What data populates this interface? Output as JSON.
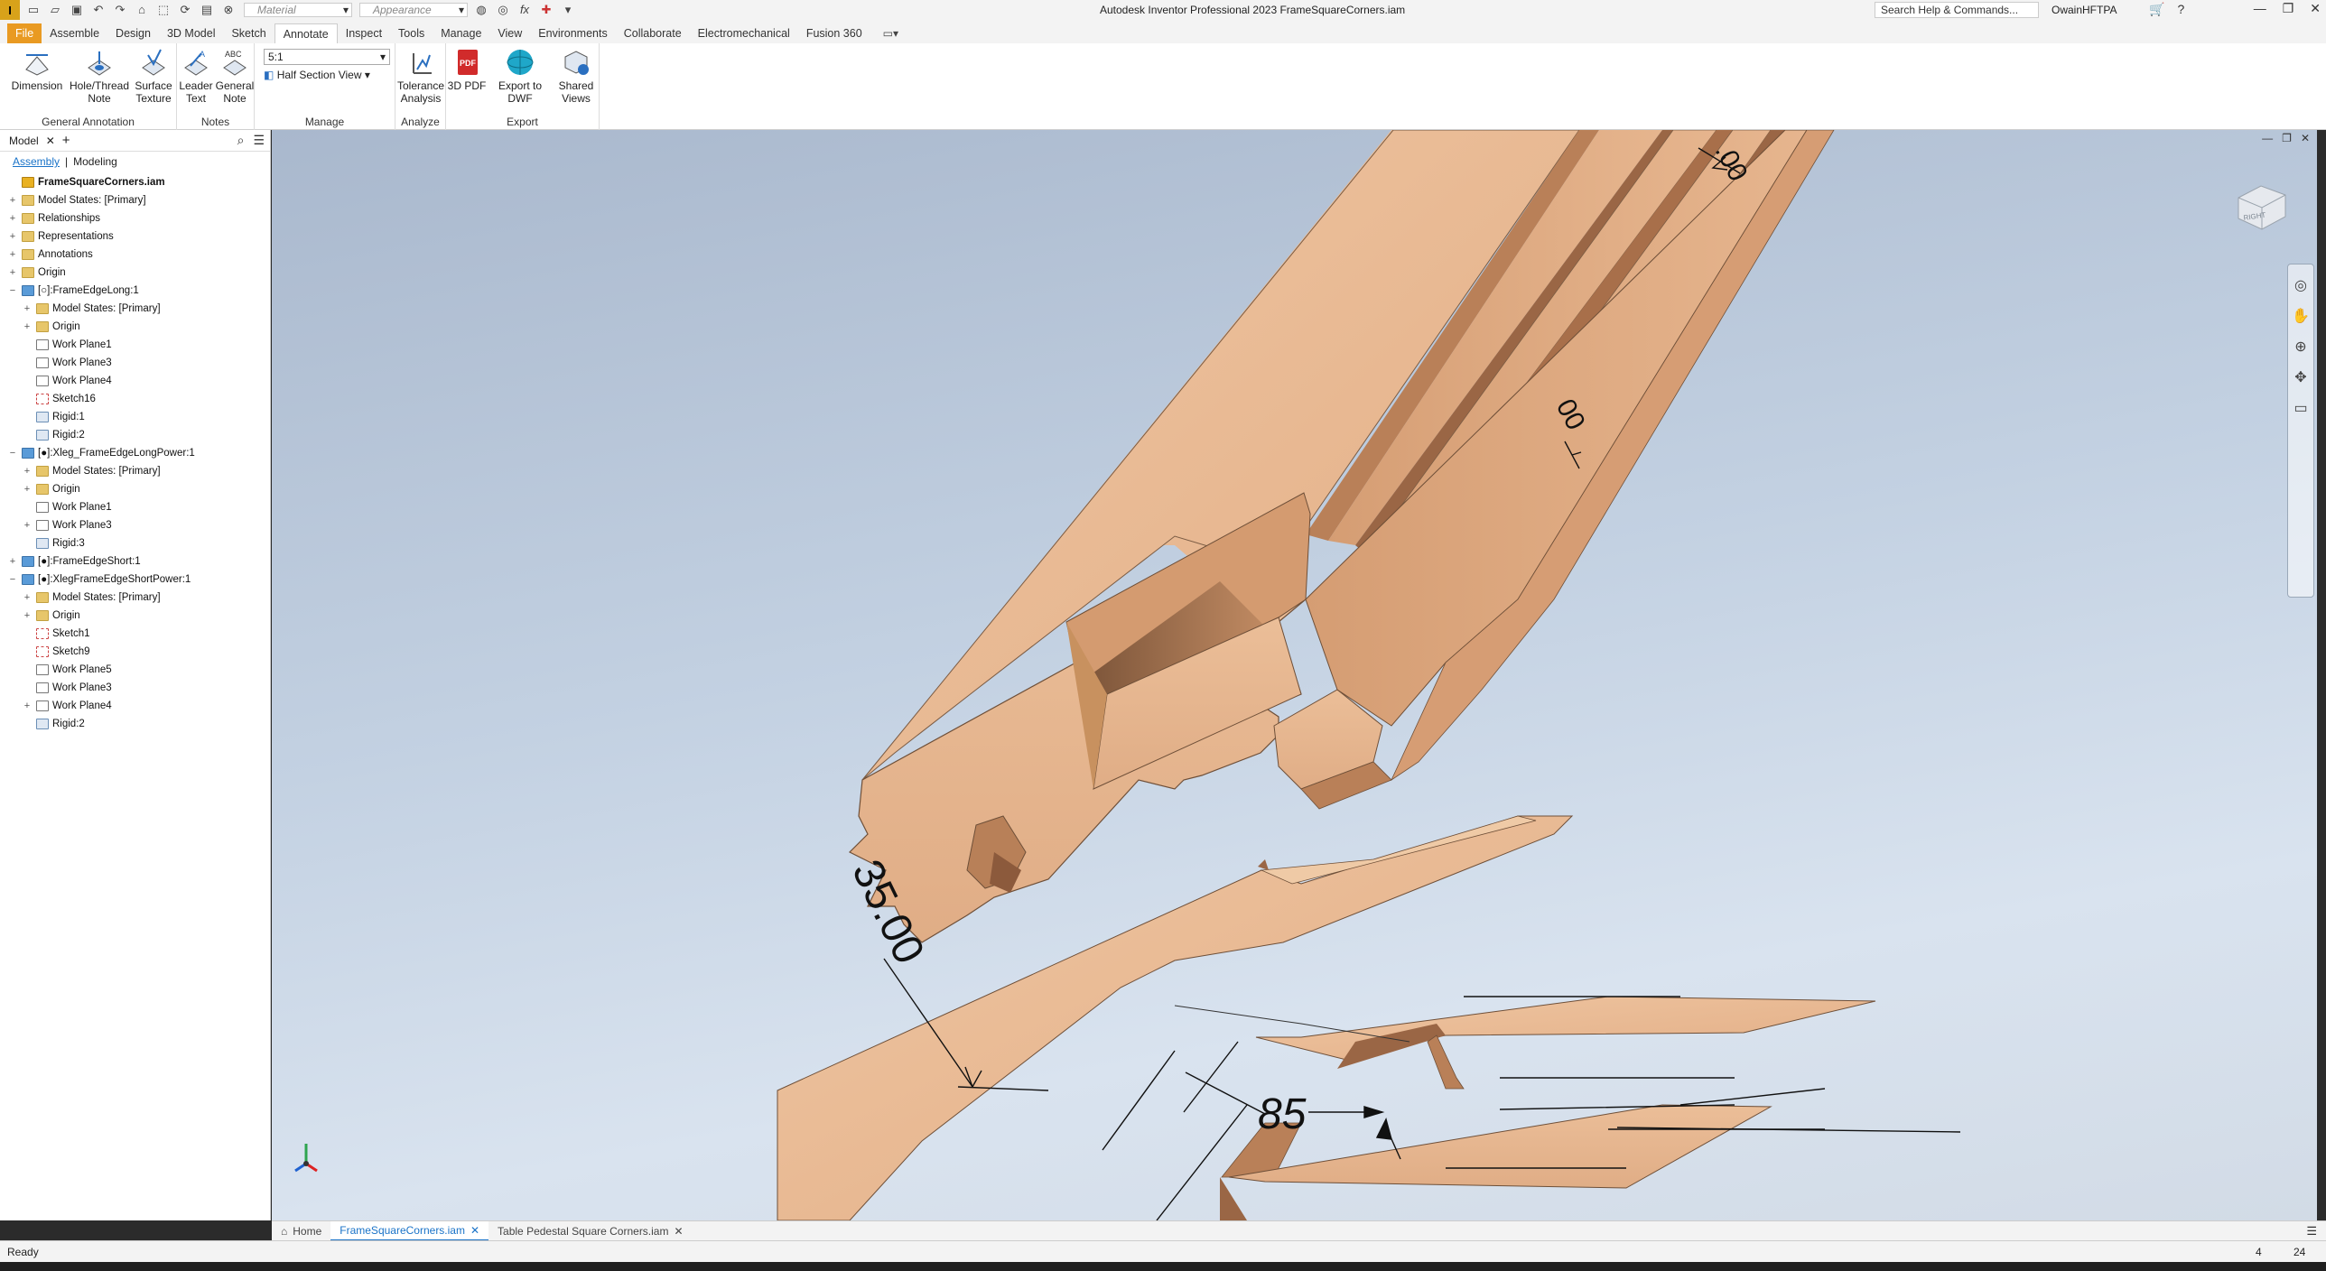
{
  "app": {
    "logo": "I",
    "window_title": "Autodesk Inventor Professional 2023   FrameSquareCorners.iam",
    "material_placeholder": "Material",
    "appearance_placeholder": "Appearance",
    "search_placeholder": "Search Help & Commands...",
    "user": "OwainHFTPA"
  },
  "ribbon_tabs": [
    "File",
    "Assemble",
    "Design",
    "3D Model",
    "Sketch",
    "Annotate",
    "Inspect",
    "Tools",
    "Manage",
    "View",
    "Environments",
    "Collaborate",
    "Electromechanical",
    "Fusion 360"
  ],
  "ribbon": {
    "general_annotation": {
      "label": "General Annotation",
      "dimension": "Dimension",
      "hole_thread_note": [
        "Hole/Thread",
        "Note"
      ],
      "surface_texture": [
        "Surface",
        "Texture"
      ]
    },
    "notes": {
      "label": "Notes",
      "leader_text": [
        "Leader",
        "Text"
      ],
      "general_note": [
        "General",
        "Note"
      ],
      "general_note_icon_text": "ABC"
    },
    "manage": {
      "label": "Manage",
      "scale": "5:1",
      "half_section_view": "Half Section View"
    },
    "analyze": {
      "label": "Analyze",
      "tolerance_analysis": [
        "Tolerance",
        "Analysis"
      ]
    },
    "export": {
      "label": "Export",
      "pdf": "3D PDF",
      "pdf_icon_text": "PDF",
      "dwf": "Export to DWF",
      "shared_views": [
        "Shared",
        "Views"
      ]
    }
  },
  "browser": {
    "tab": "Model",
    "sub_tabs": [
      "Assembly",
      "Modeling"
    ],
    "tree": [
      {
        "label": "FrameSquareCorners.iam",
        "level": 0,
        "icon": "asm",
        "exp": ""
      },
      {
        "label": "Model States: [Primary]",
        "level": 0,
        "icon": "folder",
        "exp": "+"
      },
      {
        "label": "Relationships",
        "level": 0,
        "icon": "folder",
        "exp": "+"
      },
      {
        "label": "Representations",
        "level": 0,
        "icon": "folder",
        "exp": "+"
      },
      {
        "label": "Annotations",
        "level": 0,
        "icon": "folder",
        "exp": "+"
      },
      {
        "label": "Origin",
        "level": 0,
        "icon": "folder",
        "exp": "+"
      },
      {
        "label": "[○]:FrameEdgeLong:1",
        "level": 0,
        "icon": "part",
        "exp": "−"
      },
      {
        "label": "Model States: [Primary]",
        "level": 1,
        "icon": "folder",
        "exp": "+"
      },
      {
        "label": "Origin",
        "level": 1,
        "icon": "folder",
        "exp": "+"
      },
      {
        "label": "Work Plane1",
        "level": 1,
        "icon": "plane",
        "exp": ""
      },
      {
        "label": "Work Plane3",
        "level": 1,
        "icon": "plane",
        "exp": ""
      },
      {
        "label": "Work Plane4",
        "level": 1,
        "icon": "plane",
        "exp": ""
      },
      {
        "label": "Sketch16",
        "level": 1,
        "icon": "sketch",
        "exp": ""
      },
      {
        "label": "Rigid:1",
        "level": 1,
        "icon": "rigid",
        "exp": ""
      },
      {
        "label": "Rigid:2",
        "level": 1,
        "icon": "rigid",
        "exp": ""
      },
      {
        "label": "[●]:Xleg_FrameEdgeLongPower:1",
        "level": 0,
        "icon": "part",
        "exp": "−"
      },
      {
        "label": "Model States: [Primary]",
        "level": 1,
        "icon": "folder",
        "exp": "+"
      },
      {
        "label": "Origin",
        "level": 1,
        "icon": "folder",
        "exp": "+"
      },
      {
        "label": "Work Plane1",
        "level": 1,
        "icon": "plane",
        "exp": ""
      },
      {
        "label": "Work Plane3",
        "level": 1,
        "icon": "plane",
        "exp": "+"
      },
      {
        "label": "Rigid:3",
        "level": 1,
        "icon": "rigid",
        "exp": ""
      },
      {
        "label": "[●]:FrameEdgeShort:1",
        "level": 0,
        "icon": "part",
        "exp": "+"
      },
      {
        "label": "[●]:XlegFrameEdgeShortPower:1",
        "level": 0,
        "icon": "part",
        "exp": "−"
      },
      {
        "label": "Model States: [Primary]",
        "level": 1,
        "icon": "folder",
        "exp": "+"
      },
      {
        "label": "Origin",
        "level": 1,
        "icon": "folder",
        "exp": "+"
      },
      {
        "label": "Sketch1",
        "level": 1,
        "icon": "sketch",
        "exp": ""
      },
      {
        "label": "Sketch9",
        "level": 1,
        "icon": "sketch",
        "exp": ""
      },
      {
        "label": "Work Plane5",
        "level": 1,
        "icon": "plane",
        "exp": ""
      },
      {
        "label": "Work Plane3",
        "level": 1,
        "icon": "plane",
        "exp": ""
      },
      {
        "label": "Work Plane4",
        "level": 1,
        "icon": "plane",
        "exp": "+"
      },
      {
        "label": "Rigid:2",
        "level": 1,
        "icon": "rigid",
        "exp": ""
      }
    ]
  },
  "viewport": {
    "dim_35": "35.00",
    "dim_85": "85",
    "dim_top": ".00",
    "dim_mid": "00",
    "viewcube_label": "RIGHT"
  },
  "doc_tabs": {
    "home": "Home",
    "active": "FrameSquareCorners.iam",
    "other": "Table Pedestal Square Corners.iam"
  },
  "status": {
    "text": "Ready",
    "n1": "4",
    "n2": "24"
  },
  "colors": {
    "file_tab": "#e99a22",
    "wood": "#e9b893",
    "wood_dark": "#c98f66",
    "accent": "#1a73c8"
  }
}
